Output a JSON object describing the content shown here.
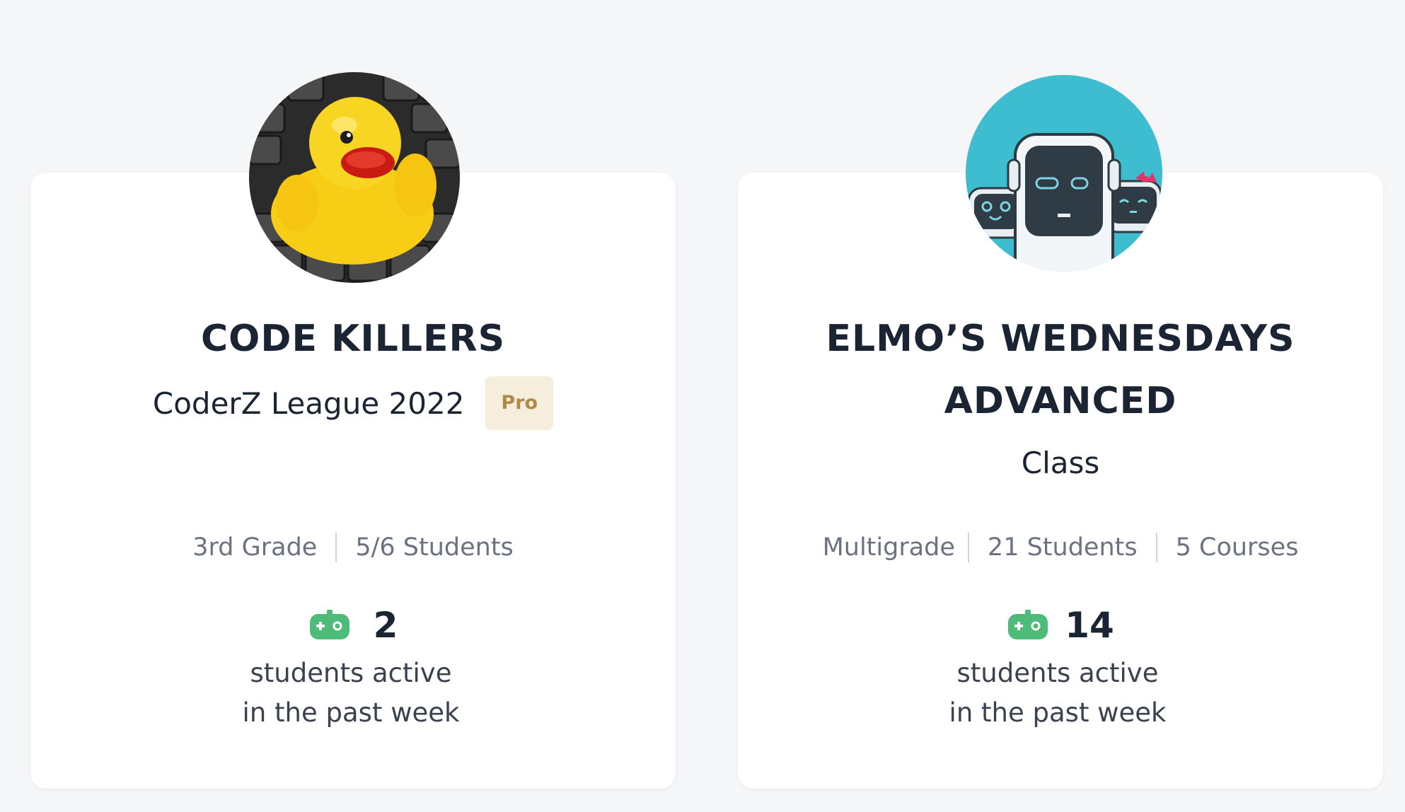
{
  "cards": [
    {
      "title": "CODE KILLERS",
      "subtitle": "CoderZ League 2022",
      "badge": "Pro",
      "avatar_icon": "rubber-duck-on-keyboard",
      "meta": [
        "3rd Grade",
        "5/6 Students"
      ],
      "active_count": "2",
      "active_label_line1": "students active",
      "active_label_line2": "in the past week"
    },
    {
      "title_line1": "ELMO’S WEDNESDAYS",
      "title_line2": "ADVANCED",
      "subtitle": "Class",
      "avatar_icon": "robot-characters",
      "meta": [
        "Multigrade",
        "21 Students",
        "5 Courses"
      ],
      "active_count": "14",
      "active_label_line1": "students active",
      "active_label_line2": "in the past week"
    }
  ],
  "colors": {
    "background": "#f5f6f8",
    "card": "#ffffff",
    "title": "#1b2433",
    "meta": "#6b7280",
    "badge_bg": "#f6eedc",
    "badge_text": "#b0894a",
    "gamepad": "#4cbc78",
    "robot_bg": "#3fbdd0"
  }
}
